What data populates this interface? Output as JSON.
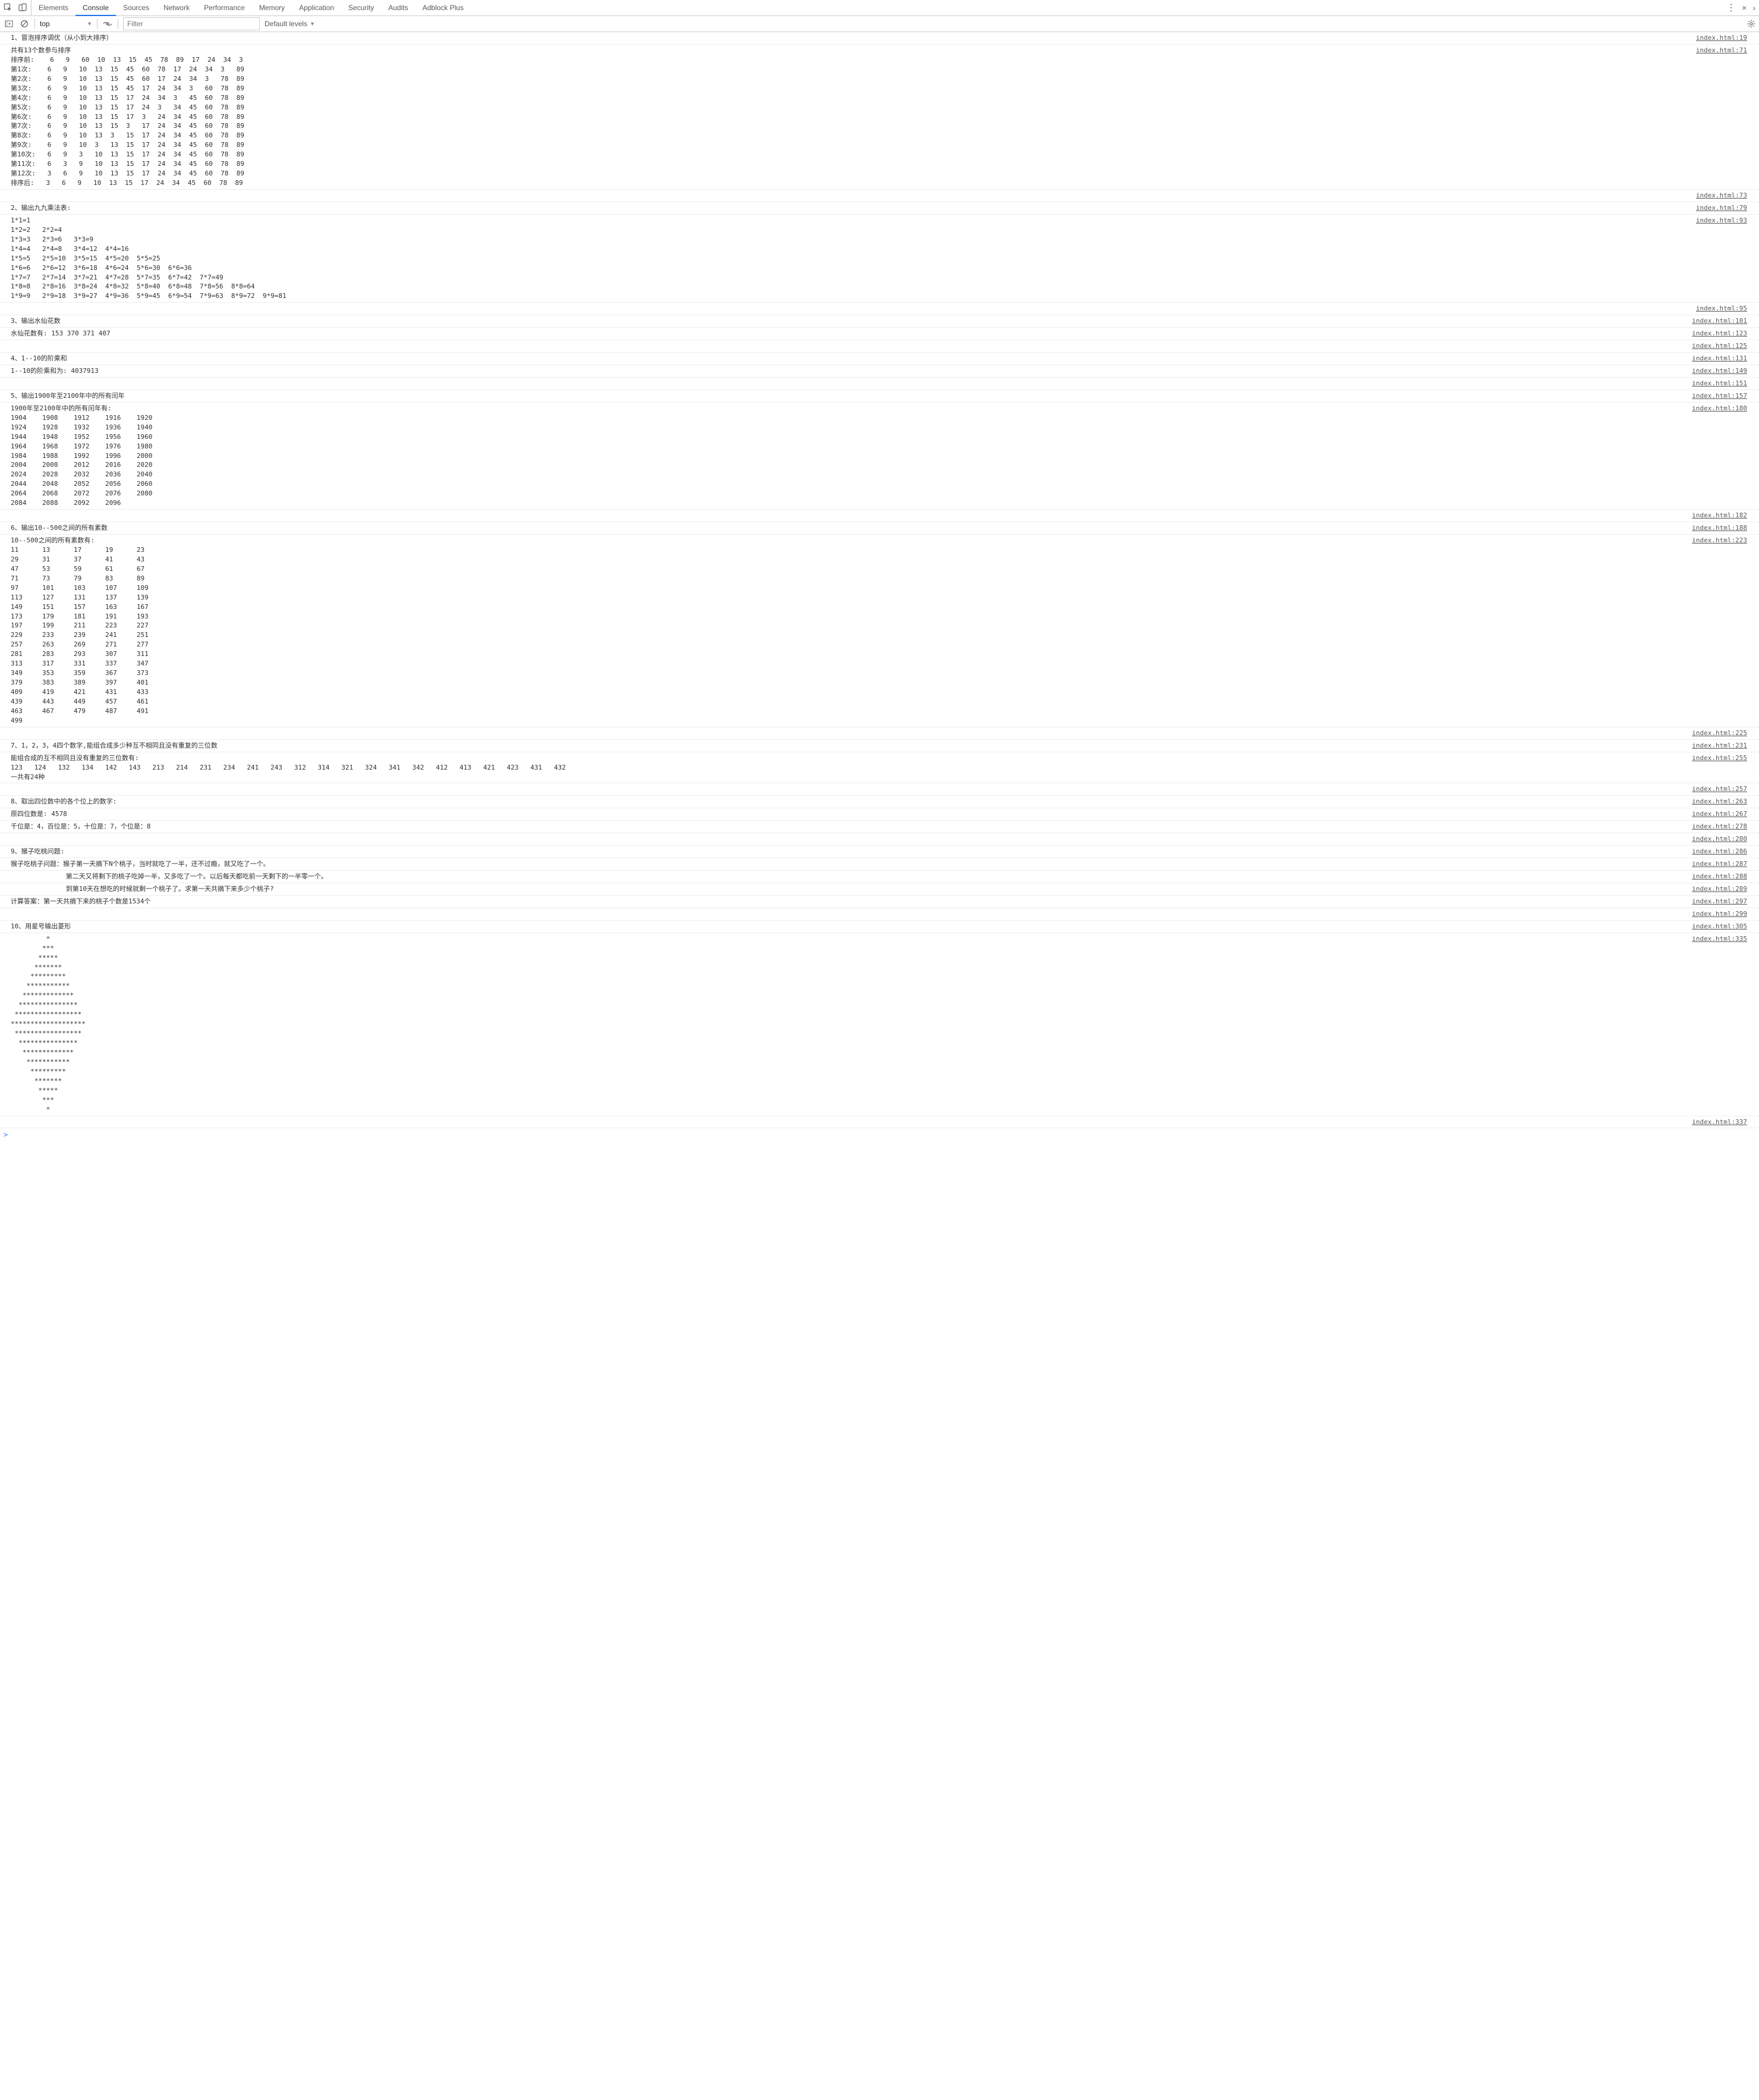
{
  "tabs": [
    "Elements",
    "Console",
    "Sources",
    "Network",
    "Performance",
    "Memory",
    "Application",
    "Security",
    "Audits",
    "Adblock Plus"
  ],
  "active_tab": 1,
  "toolbar": {
    "context": "top",
    "filter_placeholder": "Filter",
    "levels": "Default levels"
  },
  "prompt": ">",
  "logs": [
    {
      "src": "index.html:19",
      "text": "1、冒泡排序调优（从小到大排序）"
    },
    {
      "src": "index.html:71",
      "text": "共有13个数参与排序\n排序前:    6   9   60  10  13  15  45  78  89  17  24  34  3\n第1次:    6   9   10  13  15  45  60  78  17  24  34  3   89\n第2次:    6   9   10  13  15  45  60  17  24  34  3   78  89\n第3次:    6   9   10  13  15  45  17  24  34  3   60  78  89\n第4次:    6   9   10  13  15  17  24  34  3   45  60  78  89\n第5次:    6   9   10  13  15  17  24  3   34  45  60  78  89\n第6次:    6   9   10  13  15  17  3   24  34  45  60  78  89\n第7次:    6   9   10  13  15  3   17  24  34  45  60  78  89\n第8次:    6   9   10  13  3   15  17  24  34  45  60  78  89\n第9次:    6   9   10  3   13  15  17  24  34  45  60  78  89\n第10次:   6   9   3   10  13  15  17  24  34  45  60  78  89\n第11次:   6   3   9   10  13  15  17  24  34  45  60  78  89\n第12次:   3   6   9   10  13  15  17  24  34  45  60  78  89\n排序后:   3   6   9   10  13  15  17  24  34  45  60  78  89"
    },
    {
      "src": "index.html:73",
      "text": " "
    },
    {
      "src": "index.html:79",
      "text": "2、输出九九乘法表:"
    },
    {
      "src": "index.html:93",
      "text": "1*1=1\n1*2=2   2*2=4\n1*3=3   2*3=6   3*3=9\n1*4=4   2*4=8   3*4=12  4*4=16\n1*5=5   2*5=10  3*5=15  4*5=20  5*5=25\n1*6=6   2*6=12  3*6=18  4*6=24  5*6=30  6*6=36\n1*7=7   2*7=14  3*7=21  4*7=28  5*7=35  6*7=42  7*7=49\n1*8=8   2*8=16  3*8=24  4*8=32  5*8=40  6*8=48  7*8=56  8*8=64\n1*9=9   2*9=18  3*9=27  4*9=36  5*9=45  6*9=54  7*9=63  8*9=72  9*9=81"
    },
    {
      "src": "index.html:95",
      "text": " "
    },
    {
      "src": "index.html:101",
      "text": "3、输出水仙花数"
    },
    {
      "src": "index.html:123",
      "text": "水仙花数有: 153 370 371 407 "
    },
    {
      "src": "index.html:125",
      "text": " "
    },
    {
      "src": "index.html:131",
      "text": "4、1--10的阶乘和"
    },
    {
      "src": "index.html:149",
      "text": "1--10的阶乘和为: 4037913"
    },
    {
      "src": "index.html:151",
      "text": " "
    },
    {
      "src": "index.html:157",
      "text": "5、输出1900年至2100年中的所有闰年"
    },
    {
      "src": "index.html:180",
      "text": "1900年至2100年中的所有闰年有:\n1904    1908    1912    1916    1920\n1924    1928    1932    1936    1940\n1944    1948    1952    1956    1960\n1964    1968    1972    1976    1980\n1984    1988    1992    1996    2000\n2004    2008    2012    2016    2020\n2024    2028    2032    2036    2040\n2044    2048    2052    2056    2060\n2064    2068    2072    2076    2080\n2084    2088    2092    2096"
    },
    {
      "src": "index.html:182",
      "text": " "
    },
    {
      "src": "index.html:188",
      "text": "6、输出10--500之间的所有素数"
    },
    {
      "src": "index.html:223",
      "text": "10--500之间的所有素数有:\n11      13      17      19      23\n29      31      37      41      43\n47      53      59      61      67\n71      73      79      83      89\n97      101     103     107     109\n113     127     131     137     139\n149     151     157     163     167\n173     179     181     191     193\n197     199     211     223     227\n229     233     239     241     251\n257     263     269     271     277\n281     283     293     307     311\n313     317     331     337     347\n349     353     359     367     373\n379     383     389     397     401\n409     419     421     431     433\n439     443     449     457     461\n463     467     479     487     491\n499"
    },
    {
      "src": "index.html:225",
      "text": " "
    },
    {
      "src": "index.html:231",
      "text": "7、1，2，3，4四个数字,能组合成多少种互不相同且没有重复的三位数"
    },
    {
      "src": "index.html:255",
      "text": "能组合成的互不相同且没有重复的三位数有:\n123   124   132   134   142   143   213   214   231   234   241   243   312   314   321   324   341   342   412   413   421   423   431   432   \n一共有24种"
    },
    {
      "src": "index.html:257",
      "text": " "
    },
    {
      "src": "index.html:263",
      "text": "8、取出四位数中的各个位上的数字:"
    },
    {
      "src": "index.html:267",
      "text": "原四位数是: 4578"
    },
    {
      "src": "index.html:278",
      "text": "千位是：4，百位是：5，十位是：7，个位是：8"
    },
    {
      "src": "index.html:280",
      "text": " "
    },
    {
      "src": "index.html:286",
      "text": "9、猴子吃桃问题:"
    },
    {
      "src": "index.html:287",
      "text": "猴子吃桃子问题：猴子第一天摘下N个桃子，当时就吃了一半，还不过瘾，就又吃了一个。"
    },
    {
      "src": "index.html:288",
      "text": "              第二天又将剩下的桃子吃掉一半，又多吃了一个。以后每天都吃前一天剩下的一半零一个。"
    },
    {
      "src": "index.html:289",
      "text": "              到第10天在想吃的时候就剩一个桃子了。求第一天共摘下来多少个桃子?"
    },
    {
      "src": "index.html:297",
      "text": "计算答案：第一天共摘下来的桃子个数是1534个"
    },
    {
      "src": "index.html:299",
      "text": " "
    },
    {
      "src": "index.html:305",
      "text": "10、用星号输出菱形"
    },
    {
      "src": "index.html:335",
      "text": "         *\n        ***\n       *****\n      *******\n     *********\n    ***********\n   *************\n  ***************\n *****************\n*******************\n *****************\n  ***************\n   *************\n    ***********\n     *********\n      *******\n       *****\n        ***\n         *"
    },
    {
      "src": "index.html:337",
      "text": " "
    }
  ]
}
